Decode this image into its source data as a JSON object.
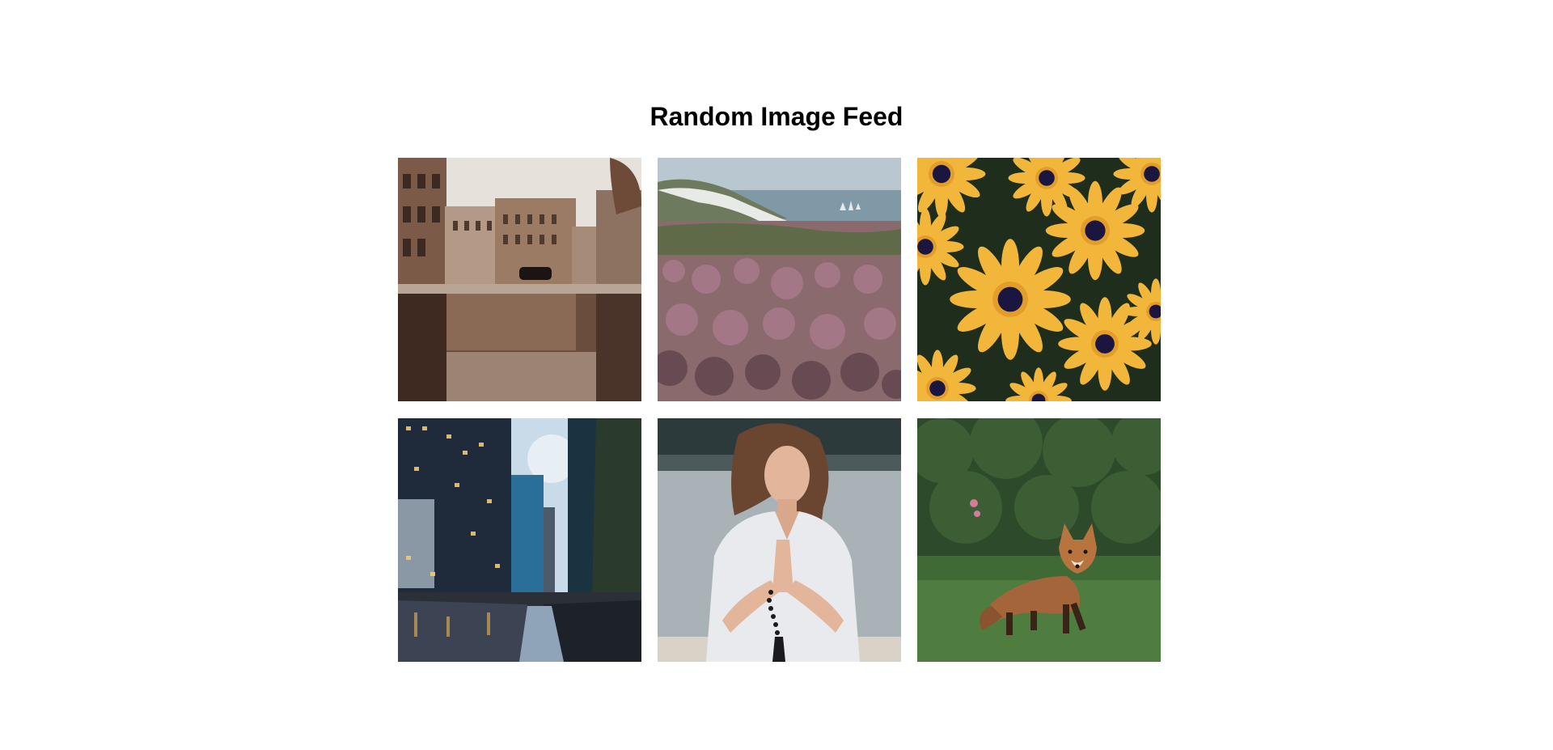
{
  "page": {
    "title": "Random Image Feed"
  },
  "feed": {
    "images": [
      {
        "subject": "city-street-reflection",
        "palette": {
          "sky": "#e4dfd8",
          "building": "#8a6a55",
          "water": "#4a3328"
        }
      },
      {
        "subject": "coastal-heather-cliffs",
        "palette": {
          "sky": "#b8c6cf",
          "sea": "#7d96a4",
          "heather": "#9a6b7a"
        }
      },
      {
        "subject": "yellow-daisies",
        "palette": {
          "petal": "#f2b63a",
          "center": "#1b1640",
          "leaf": "#1f2e1c"
        }
      },
      {
        "subject": "city-skyline-wet-street",
        "palette": {
          "sky": "#c9dbe8",
          "building": "#1f2a3a",
          "street": "#2a2f38"
        }
      },
      {
        "subject": "woman-praying-lakeside",
        "palette": {
          "background": "#a9b3b7",
          "shirt": "#e8eaee",
          "hair": "#6a4530"
        }
      },
      {
        "subject": "fox-on-grass",
        "palette": {
          "foliage": "#2d4a2a",
          "grass": "#3f6a35",
          "fox": "#a5653a"
        }
      }
    ]
  }
}
